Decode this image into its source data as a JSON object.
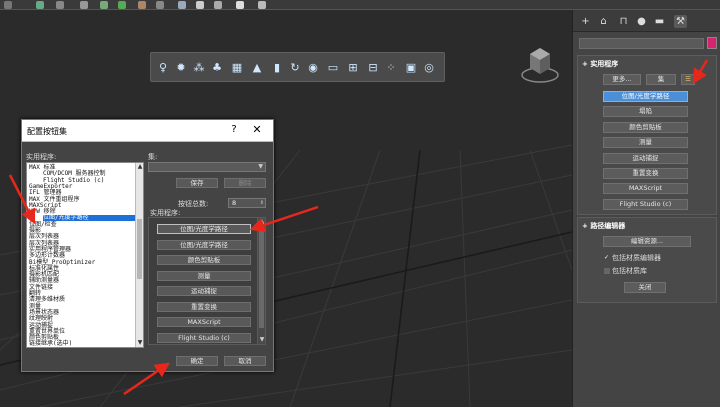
{
  "dialog": {
    "title": "配置按钮集",
    "help_label": "?",
    "close_label": "✕",
    "utilities_label": "实用程序:",
    "utilities": [
      {
        "text": "MAX 标准",
        "indent": false
      },
      {
        "text": "COM/DCOM 服务器控制",
        "indent": true
      },
      {
        "text": "Flight Studio (c)",
        "indent": true
      },
      {
        "text": "GameExporter",
        "indent": false
      },
      {
        "text": "IFL 管理器",
        "indent": false
      },
      {
        "text": "MAX 文件重组程序",
        "indent": false
      },
      {
        "text": "MAXScript",
        "indent": false
      },
      {
        "text": "UVW 移除",
        "indent": false
      },
      {
        "text": "位图/光度学路径",
        "indent": false,
        "selected": true
      },
      {
        "text": "位图/检查",
        "indent": false
      },
      {
        "text": "摄影",
        "indent": false
      },
      {
        "text": "层次列表器",
        "indent": false
      },
      {
        "text": "层次列表器",
        "indent": false
      },
      {
        "text": "实用程序管理器",
        "indent": false
      },
      {
        "text": "多边形计数器",
        "indent": false
      },
      {
        "text": "Bi模型 ProOptimizer",
        "indent": false
      },
      {
        "text": "标准化属性",
        "indent": false
      },
      {
        "text": "摄影机匹配",
        "indent": false
      },
      {
        "text": "辅助测量器",
        "indent": false
      },
      {
        "text": "文件链接",
        "indent": false
      },
      {
        "text": "翻转",
        "indent": false
      },
      {
        "text": "清理多维材质",
        "indent": false
      },
      {
        "text": "测量",
        "indent": false
      },
      {
        "text": "场景状态器",
        "indent": false
      },
      {
        "text": "纹理映射",
        "indent": false
      },
      {
        "text": "运动捕捉",
        "indent": false
      },
      {
        "text": "重置世界单位",
        "indent": false
      },
      {
        "text": "颜色剪贴板",
        "indent": false
      },
      {
        "text": "链接继承(选中)",
        "indent": false
      }
    ],
    "sets_label": "集:",
    "save_label": "保存",
    "delete_label": "删除",
    "total_buttons_label": "按钮总数:",
    "total_buttons_value": "8",
    "utilities_right_label": "实用程序:",
    "slot_buttons": [
      "位图/光度学路径",
      "位图/光度学路径",
      "颜色剪贴板",
      "测量",
      "运动捕捉",
      "重置变换",
      "MAXScript",
      "Flight Studio (c)"
    ],
    "ok_label": "确定",
    "cancel_label": "取消"
  },
  "command_panel": {
    "tab_icons": [
      "create-icon",
      "modify-icon",
      "hierarchy-icon",
      "motion-icon",
      "display-icon",
      "utilities-icon"
    ],
    "utilities_rollout_title": "实用程序",
    "more_label": "更多...",
    "sets_label": "集",
    "utility_buttons": [
      "位图/光度学路径",
      "塌陷",
      "颜色剪贴板",
      "测量",
      "运动捕捉",
      "重置变换",
      "MAXScript",
      "Flight Studio (c)"
    ],
    "path_editor_title": "路径编辑器",
    "edit_resources_label": "编辑资源...",
    "include_material_editor": "包括材质编辑器",
    "include_material_library": "包括材质库",
    "close_label": "关闭"
  },
  "colors": {
    "accent_selection": "#1e70d6",
    "active_button": "#4a8fd8",
    "annotation_arrow": "#e8271c",
    "object_color_swatch": "#d6236f"
  }
}
